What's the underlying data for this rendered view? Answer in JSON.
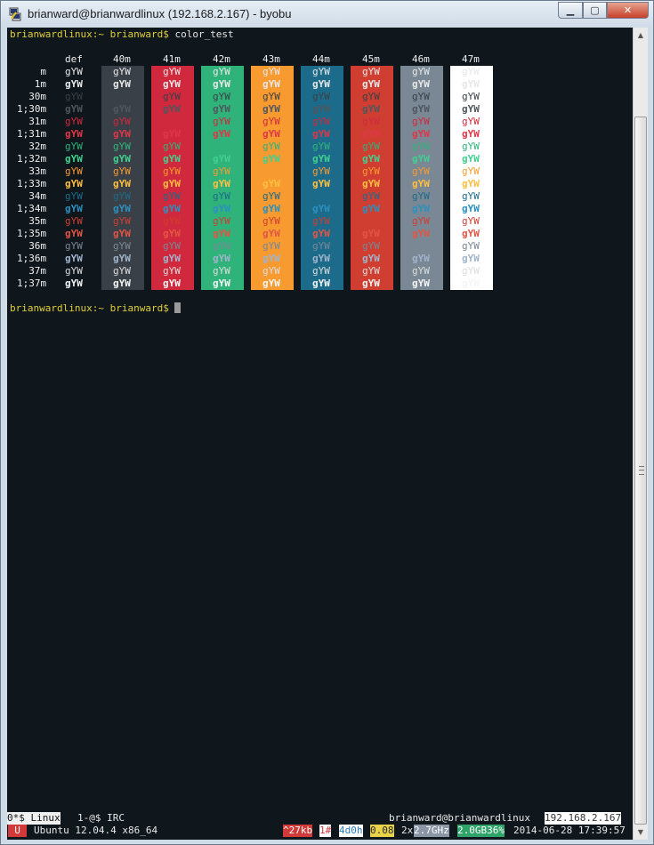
{
  "window": {
    "title": "brianward@brianwardlinux (192.168.2.167) - byobu",
    "controls": {
      "minimize": "▁",
      "maximize": "▢",
      "close": "✕"
    }
  },
  "terminal": {
    "prompt_host": "brianwardlinux:~",
    "prompt_user": "brianward$",
    "command": "color_test",
    "sample": "gYW",
    "column_headers": [
      "def",
      "40m",
      "41m",
      "42m",
      "43m",
      "44m",
      "45m",
      "46m",
      "47m"
    ],
    "row_labels": [
      "m",
      "1m",
      "30m",
      "1;30m",
      "31m",
      "1;31m",
      "32m",
      "1;32m",
      "33m",
      "1;33m",
      "34m",
      "1;34m",
      "35m",
      "1;35m",
      "36m",
      "1;36m",
      "37m",
      "1;37m"
    ],
    "background_colors": [
      "#0f161c",
      "#3a4047",
      "#d0283c",
      "#2fb37a",
      "#f79a30",
      "#1d6b8a",
      "#cf3e31",
      "#7a8795",
      "#ffffff"
    ],
    "foreground_colors": {
      "default": "#e8e8e8",
      "30m": "#3a4047",
      "1;30m": "#4f565e",
      "31m": "#d0283c",
      "1;31m": "#e03648",
      "32m": "#2fb37a",
      "1;32m": "#40d08f",
      "33m": "#f79a30",
      "1;33m": "#ffbf40",
      "34m": "#1d6b8a",
      "1;34m": "#2b90c0",
      "35m": "#cf3e31",
      "1;35m": "#e25544",
      "36m": "#7a8795",
      "1;36m": "#a0b4cc",
      "37m": "#dddddd",
      "1;37m": "#f5f5f5"
    }
  },
  "status_bar": {
    "line1": {
      "window0": "0*$ Linux",
      "window1": "1-@$ IRC",
      "user_host": "brianward@brianwardlinux",
      "ip": "192.168.2.167"
    },
    "line2": {
      "distro_badge": "U",
      "distro": "Ubuntu 12.04.4 x86_64",
      "net": "^27kb",
      "users": "1#",
      "uptime": "4d0h",
      "load": "0.08",
      "cpu_count": "2x",
      "cpu_freq": "2.7GHz",
      "mem": "2.0GB36%",
      "datetime": "2014-06-28 17:39:57"
    },
    "colors": {
      "distro": "#d23a3a",
      "net": "#d23a3a",
      "users_bg": "#ffffff",
      "users_fg": "#d23a3a",
      "uptime_bg": "#ffffff",
      "uptime_fg": "#2b7bc0",
      "load_bg": "#e8d24a",
      "load_fg": "#2a2a2a",
      "cpu_bg": "#8a96a6",
      "mem_bg": "#2fa36a",
      "ip_bg": "#ffffff",
      "ip_fg": "#333333"
    }
  }
}
